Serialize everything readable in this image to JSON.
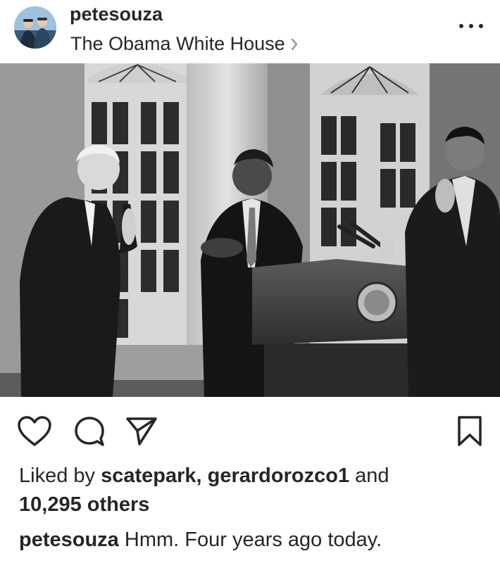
{
  "post": {
    "username": "petesouza",
    "location": "The Obama White House",
    "location_chevron": "›"
  },
  "icons": {
    "like": "heart-outline-icon",
    "comment": "speech-bubble-icon",
    "share": "paper-plane-icon",
    "save": "bookmark-icon",
    "more": "ellipsis-icon"
  },
  "likes": {
    "prefix": "Liked by",
    "user_1": "scatepark,",
    "user_2": "gerardorozco1",
    "connector": "and",
    "others": "10,295 others"
  },
  "caption": {
    "username": "petesouza",
    "text": "Hmm. Four years ago today."
  }
}
